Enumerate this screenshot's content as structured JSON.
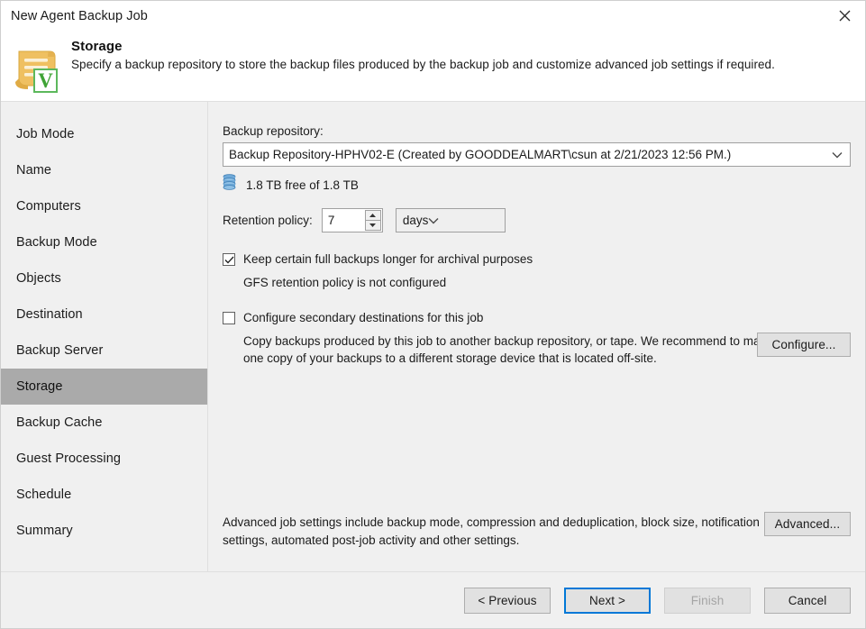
{
  "window": {
    "title": "New Agent Backup Job",
    "close_icon": "close-icon"
  },
  "header": {
    "icon": "backup-job-document-icon",
    "title": "Storage",
    "subtitle": "Specify a backup repository to store the backup files produced by the backup job and customize advanced job settings if required."
  },
  "sidebar": {
    "items": [
      {
        "label": "Job Mode",
        "active": false
      },
      {
        "label": "Name",
        "active": false
      },
      {
        "label": "Computers",
        "active": false
      },
      {
        "label": "Backup Mode",
        "active": false
      },
      {
        "label": "Objects",
        "active": false
      },
      {
        "label": "Destination",
        "active": false
      },
      {
        "label": "Backup Server",
        "active": false
      },
      {
        "label": "Storage",
        "active": true
      },
      {
        "label": "Backup Cache",
        "active": false
      },
      {
        "label": "Guest Processing",
        "active": false
      },
      {
        "label": "Schedule",
        "active": false
      },
      {
        "label": "Summary",
        "active": false
      }
    ]
  },
  "main": {
    "repository_label": "Backup repository:",
    "repository_value": "Backup Repository-HPHV02-E (Created by GOODDEALMART\\csun at 2/21/2023 12:56 PM.)",
    "repository_dropdown_icon": "chevron-down-icon",
    "free_space_icon": "storage-disk-icon",
    "free_space_text": "1.8 TB free of 1.8 TB",
    "retention_label": "Retention policy:",
    "retention_value": "7",
    "retention_unit": "days",
    "retention_unit_dropdown_icon": "chevron-down-icon",
    "spinner_up_icon": "spin-up-icon",
    "spinner_down_icon": "spin-down-icon",
    "gfs_checkbox": {
      "label": "Keep certain full backups longer for archival purposes",
      "checked": true,
      "subtext": "GFS retention policy is not configured"
    },
    "configure_button": "Configure...",
    "secondary_checkbox": {
      "label": "Configure secondary destinations for this job",
      "checked": false,
      "subtext": "Copy backups produced by this job to another backup repository, or tape. We recommend to make at least one copy of your backups to a different storage device that is located off-site."
    },
    "advanced_text": "Advanced job settings include backup mode, compression and deduplication, block size, notification settings, automated post-job activity and other settings.",
    "advanced_button": "Advanced..."
  },
  "footer": {
    "previous": "< Previous",
    "next": "Next >",
    "finish": "Finish",
    "cancel": "Cancel"
  },
  "colors": {
    "accent_focus": "#0078d7",
    "sidebar_bg": "#f0f0f0",
    "active_nav_bg": "#aaaaaa",
    "disk_icon_blue": "#3f8fd0",
    "veeam_green": "#4caf3f",
    "doc_icon_gold": "#e8b84b"
  }
}
